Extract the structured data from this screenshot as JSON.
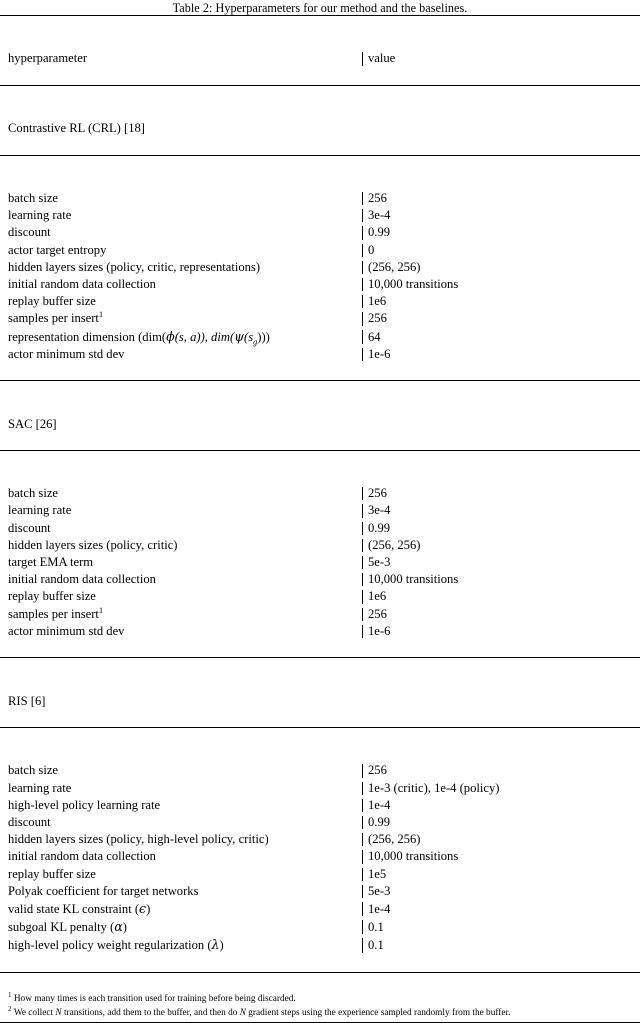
{
  "caption": "Table 2: Hyperparameters for our method and the baselines.",
  "columns": {
    "key_header": "hyperparameter",
    "value_header": "value"
  },
  "sections": [
    {
      "title": "Contrastive RL (CRL) [18]",
      "rows": [
        {
          "key": "batch size",
          "value": "256"
        },
        {
          "key": "learning rate",
          "value": "3e-4"
        },
        {
          "key": "discount",
          "value": "0.99"
        },
        {
          "key": "actor target entropy",
          "value": "0"
        },
        {
          "key": "hidden layers sizes (policy, critic, representations)",
          "value": "(256, 256)"
        },
        {
          "key": "initial random data collection",
          "value": "10,000 transitions"
        },
        {
          "key": "replay buffer size",
          "value": "1e6"
        },
        {
          "key": "samples per insert",
          "key_sup": "1",
          "value": "256"
        },
        {
          "key": "representation dimension (dim(ϕ(s, a)), dim(ψ(s_g)))",
          "value": "64",
          "math": "repdim"
        },
        {
          "key": "actor minimum std dev",
          "value": "1e-6"
        }
      ]
    },
    {
      "title": "SAC [26]",
      "rows": [
        {
          "key": "batch size",
          "value": "256"
        },
        {
          "key": "learning rate",
          "value": "3e-4"
        },
        {
          "key": "discount",
          "value": "0.99"
        },
        {
          "key": "hidden layers sizes (policy, critic)",
          "value": "(256, 256)"
        },
        {
          "key": "target EMA term",
          "value": "5e-3"
        },
        {
          "key": "initial random data collection",
          "value": "10,000 transitions"
        },
        {
          "key": "replay buffer size",
          "value": "1e6"
        },
        {
          "key": "samples per insert",
          "key_sup": "1",
          "value": "256"
        },
        {
          "key": "actor minimum std dev",
          "value": "1e-6"
        }
      ]
    },
    {
      "title": "RIS [6]",
      "rows": [
        {
          "key": "batch size",
          "value": "256"
        },
        {
          "key": "learning rate",
          "value": "1e-3 (critic), 1e-4 (policy)"
        },
        {
          "key": "high-level policy learning rate",
          "value": "1e-4"
        },
        {
          "key": "discount",
          "value": "0.99"
        },
        {
          "key": "hidden layers sizes (policy, high-level policy, critic)",
          "value": "(256, 256)"
        },
        {
          "key": "initial random data collection",
          "value": "10,000 transitions"
        },
        {
          "key": "replay buffer size",
          "value": "1e5"
        },
        {
          "key": "Polyak coefficient for target networks",
          "value": "5e-3"
        },
        {
          "key": "valid state KL constraint (ϵ)",
          "value": "1e-4",
          "math": "epsilon"
        },
        {
          "key": "subgoal KL penalty (α)",
          "value": "0.1",
          "math": "alpha"
        },
        {
          "key": "high-level policy weight regularization (λ)",
          "value": "0.1",
          "math": "lambda"
        }
      ]
    }
  ],
  "footnotes": [
    {
      "marker": "1",
      "text": "How many times is each transition used for training before being discarded."
    },
    {
      "marker": "2",
      "text_parts": [
        "We collect ",
        "N",
        " transitions, add them to the buffer, and then do ",
        "N",
        " gradient steps using the experience sampled randomly from the buffer."
      ],
      "text": "We collect N transitions, add them to the buffer, and then do N gradient steps using the experience sampled randomly from the buffer."
    }
  ],
  "math_labels": {
    "repdim_prefix": "representation dimension (dim(",
    "repdim_phi": "ϕ",
    "repdim_mid1": "(s, a)), dim(",
    "repdim_psi": "ψ",
    "repdim_mid2": "(s",
    "repdim_sub": "g",
    "repdim_suffix": ")))",
    "epsilon_prefix": "valid state KL constraint (",
    "epsilon_char": "ϵ",
    "alpha_prefix": "subgoal KL penalty (",
    "alpha_char": "α",
    "lambda_prefix": "high-level policy weight regularization (",
    "lambda_char": "λ",
    "paren_close": ")"
  },
  "style": {
    "text_color": "#000000",
    "background": "#ffffff",
    "rule_color": "#000000"
  }
}
